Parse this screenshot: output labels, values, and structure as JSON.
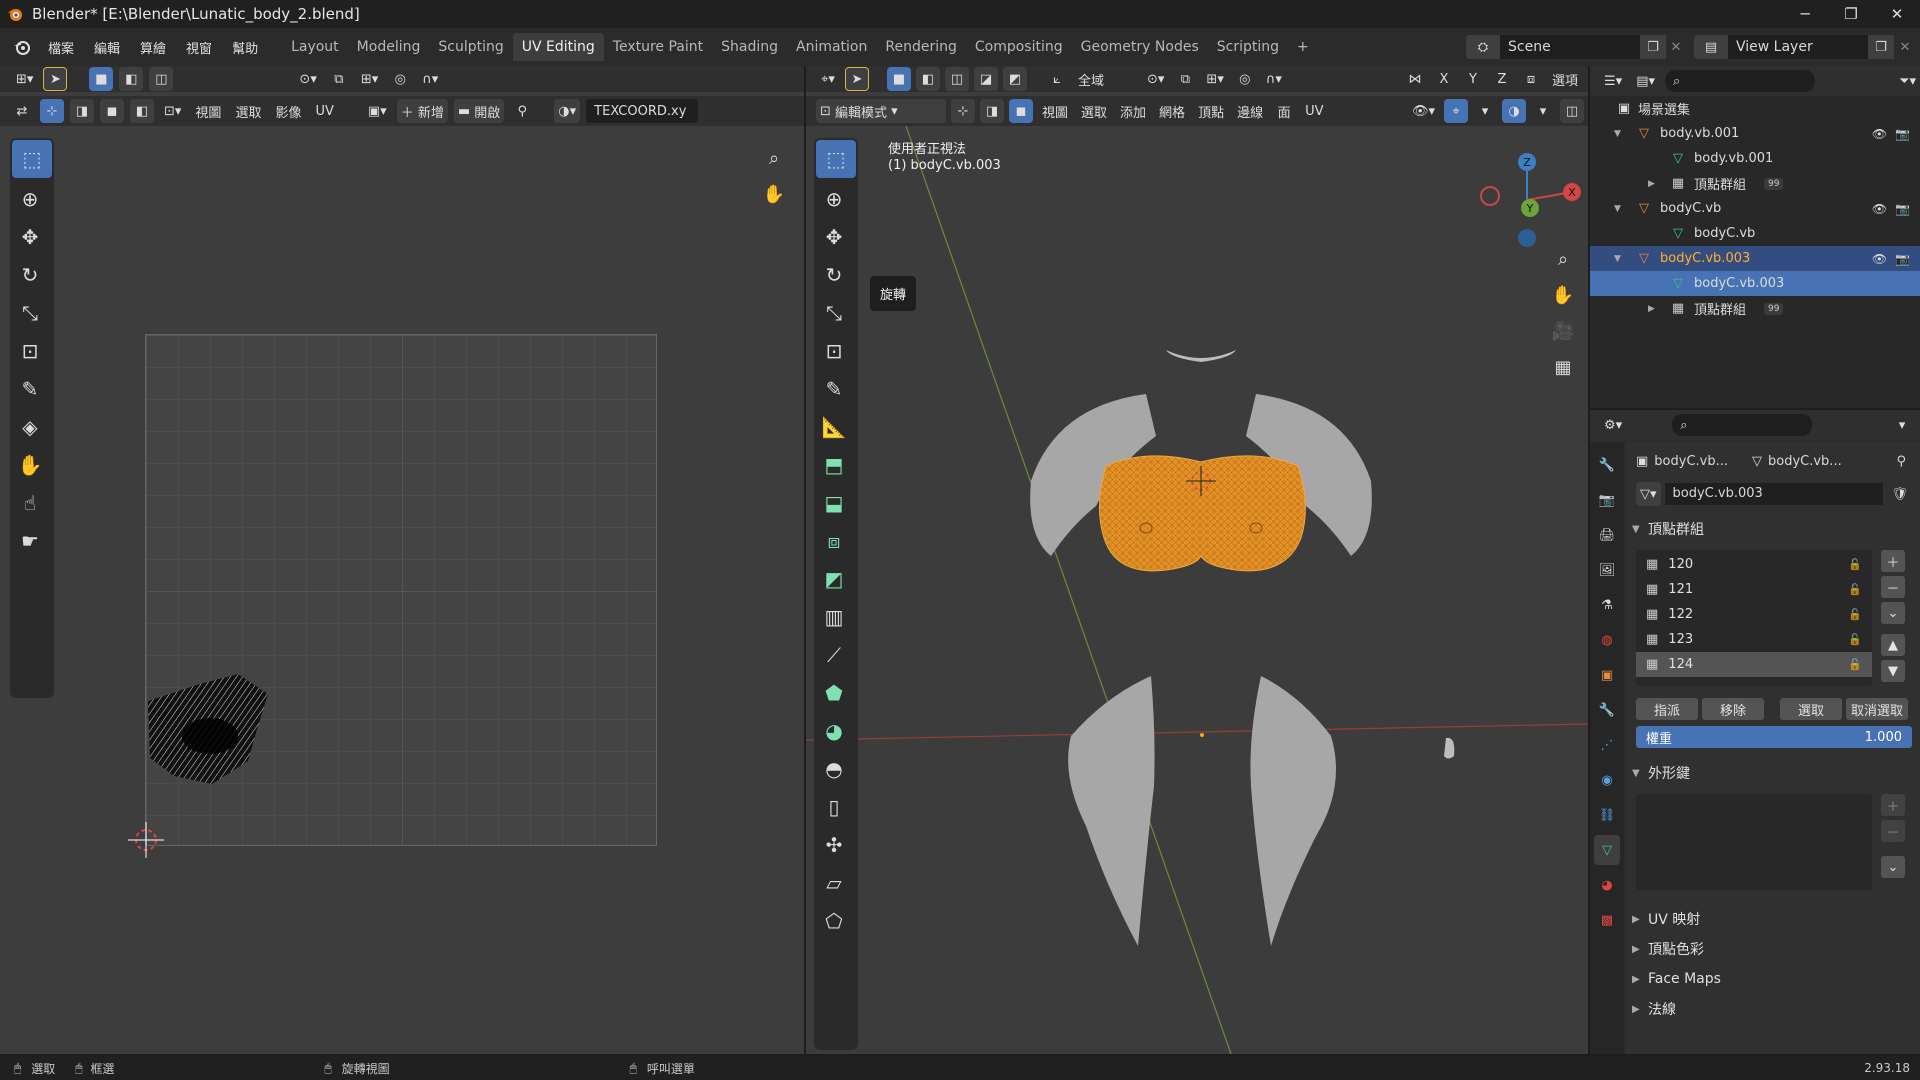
{
  "window": {
    "title": "Blender* [E:\\Blender\\Lunatic_body_2.blend]",
    "minimize": "─",
    "maximize": "❐",
    "close": "✕"
  },
  "menu": [
    "檔案",
    "編輯",
    "算繪",
    "視窗",
    "幫助"
  ],
  "workspaces": [
    "Layout",
    "Modeling",
    "Sculpting",
    "UV Editing",
    "Texture Paint",
    "Shading",
    "Animation",
    "Rendering",
    "Compositing",
    "Geometry Nodes",
    "Scripting",
    "+"
  ],
  "active_workspace": "UV Editing",
  "scene": {
    "scene_name": "Scene",
    "view_layer": "View Layer"
  },
  "uv_editor": {
    "header2": {
      "view": "視圖",
      "select": "選取",
      "image": "影像",
      "uv": "UV",
      "new": "新增",
      "open": "開啟",
      "uvmap": "TEXCOORD.xy"
    }
  },
  "viewport": {
    "mode": "編輯模式",
    "transform_orient": "全域",
    "menus": [
      "視圖",
      "選取",
      "添加",
      "網格",
      "頂點",
      "邊線",
      "面",
      "UV"
    ],
    "options": "選項",
    "axes_xyz": [
      "X",
      "Y",
      "Z"
    ],
    "overlay_title": "使用者正視法",
    "overlay_object": "(1) bodyC.vb.003",
    "tooltip": "旋轉",
    "gizmo": {
      "x": "X",
      "y": "Y",
      "z": "Z"
    }
  },
  "outliner": {
    "title": "場景選集",
    "rows": [
      {
        "label": "body.vb.001",
        "level": 1,
        "expand": "▼",
        "type": "object"
      },
      {
        "label": "body.vb.001",
        "level": 2,
        "expand": "",
        "type": "mesh"
      },
      {
        "label": "頂點群組",
        "level": 2,
        "expand": "▶",
        "type": "vgroup",
        "badge": "99"
      },
      {
        "label": "bodyC.vb",
        "level": 1,
        "expand": "▼",
        "type": "object"
      },
      {
        "label": "bodyC.vb",
        "level": 2,
        "expand": "",
        "type": "mesh"
      },
      {
        "label": "bodyC.vb.003",
        "level": 1,
        "expand": "▼",
        "type": "object",
        "selected": true
      },
      {
        "label": "bodyC.vb.003",
        "level": 2,
        "expand": "",
        "type": "mesh",
        "active": true
      },
      {
        "label": "頂點群組",
        "level": 2,
        "expand": "▶",
        "type": "vgroup",
        "badge": "99"
      }
    ]
  },
  "properties": {
    "breadcrumb_obj": "bodyC.vb...",
    "breadcrumb_mesh": "bodyC.vb...",
    "mesh_name": "bodyC.vb.003",
    "vertex_groups_title": "頂點群組",
    "vertex_groups": [
      "120",
      "121",
      "122",
      "123",
      "124"
    ],
    "active_group": "124",
    "btn_assign": "指派",
    "btn_remove": "移除",
    "btn_select": "選取",
    "btn_deselect": "取消選取",
    "weight_label": "權重",
    "weight_value": "1.000",
    "shape_keys_title": "外形鍵",
    "sections": [
      "UV 映射",
      "頂點色彩",
      "Face Maps",
      "法線"
    ]
  },
  "statusbar": {
    "select": "選取",
    "box_select": "框選",
    "rotate_view": "旋轉視圖",
    "call_menu": "呼叫選單",
    "version": "2.93.18"
  },
  "colors": {
    "accent": "#4772b3",
    "mesh_orange": "#e8962a",
    "object_orange": "#e38a3c",
    "mesh_green": "#3dc286"
  }
}
